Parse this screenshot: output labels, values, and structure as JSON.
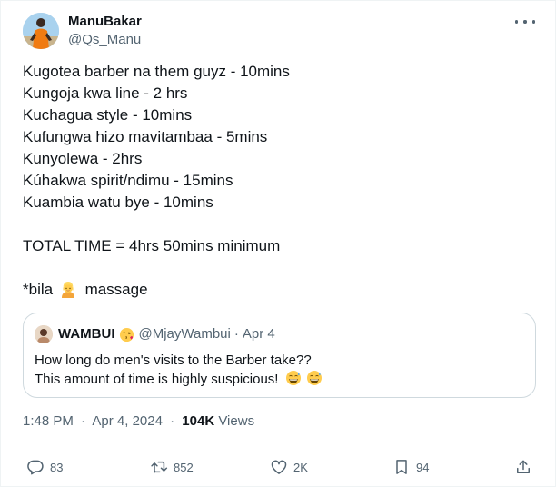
{
  "author": {
    "display_name": "ManuBakar",
    "handle": "@Qs_Manu"
  },
  "tweet": {
    "lines": [
      "Kugotea barber na them guyz - 10mins",
      "Kungoja kwa line - 2 hrs",
      "Kuchagua style - 10mins",
      "Kufungwa hizo mavitambaa - 5mins",
      "Kunyolewa - 2hrs",
      "Kúhakwa spirit/ndimu - 15mins",
      "Kuambia watu bye - 10mins"
    ],
    "total": "TOTAL TIME = 4hrs 50mins minimum",
    "footnote_prefix": "*bila",
    "footnote_emoji": "person-blond-hair",
    "footnote_suffix": "massage"
  },
  "quote": {
    "display_name": "WAMBUI",
    "name_emoji": "face-blowing-kiss",
    "handle": "@MjayWambui",
    "separator": "·",
    "date": "Apr 4",
    "lines": [
      "How long do men's visits to the Barber take??",
      "This amount of time is highly suspicious!"
    ],
    "line2_emojis": [
      "grinning-sweat-face",
      "grinning-sweat-face"
    ]
  },
  "meta": {
    "time": "1:48 PM",
    "separator": "·",
    "date": "Apr 4, 2024",
    "views_count": "104K",
    "views_label": "Views"
  },
  "actions": {
    "replies": "83",
    "reposts": "852",
    "likes": "2K",
    "bookmarks": "94"
  },
  "colors": {
    "text": "#0f1419",
    "secondary": "#536471",
    "border": "#cfd9de",
    "divider": "#eff3f4"
  }
}
